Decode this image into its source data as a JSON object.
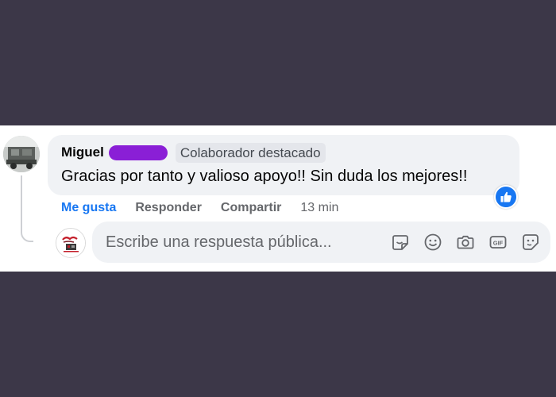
{
  "comment": {
    "author": "Miguel",
    "badge": "Colaborador destacado",
    "text": "Gracias por tanto y valioso apoyo!! Sin duda los mejores!!",
    "reaction_icon": "thumbs-up-icon",
    "actions": {
      "like": "Me gusta",
      "reply": "Responder",
      "share": "Compartir"
    },
    "time": "13 min"
  },
  "reply": {
    "placeholder": "Escribe una respuesta pública...",
    "icons": [
      "sticker-icon",
      "emoji-icon",
      "camera-icon",
      "gif-icon",
      "avatar-sticker-icon"
    ]
  },
  "colors": {
    "background": "#3c3748",
    "accent": "#1877f2",
    "bubble": "#f0f2f5",
    "redaction": "#8a1fd6"
  }
}
